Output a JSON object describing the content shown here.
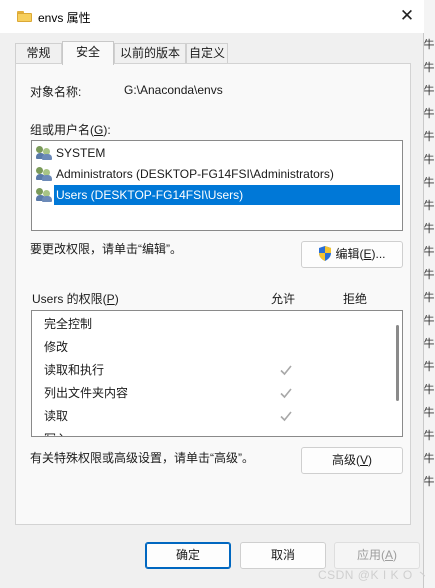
{
  "window": {
    "title": "envs 属性",
    "close_glyph": "✕"
  },
  "tabs": [
    {
      "label": "常规",
      "active": false
    },
    {
      "label": "安全",
      "active": true
    },
    {
      "label": "以前的版本",
      "active": false
    },
    {
      "label": "自定义",
      "active": false
    }
  ],
  "security": {
    "object_name_label": "对象名称:",
    "object_name_value": "G:\\Anaconda\\envs",
    "group_label_pre": "组或用户名(",
    "group_label_key": "G",
    "group_label_post": "):",
    "users": [
      {
        "name": "SYSTEM",
        "selected": false
      },
      {
        "name": "Administrators (DESKTOP-FG14FSI\\Administrators)",
        "selected": false
      },
      {
        "name": "Users (DESKTOP-FG14FSI\\Users)",
        "selected": true
      }
    ],
    "edit_hint": "要更改权限，请单击“编辑”。",
    "edit_button_pre": "编辑(",
    "edit_button_key": "E",
    "edit_button_post": ")...",
    "permissions_label_pre": "Users 的权限(",
    "permissions_label_key": "P",
    "permissions_label_post": ")",
    "allow_header": "允许",
    "deny_header": "拒绝",
    "permissions": [
      {
        "name": "完全控制",
        "allow": false,
        "deny": false
      },
      {
        "name": "修改",
        "allow": false,
        "deny": false
      },
      {
        "name": "读取和执行",
        "allow": true,
        "deny": false
      },
      {
        "name": "列出文件夹内容",
        "allow": true,
        "deny": false
      },
      {
        "name": "读取",
        "allow": true,
        "deny": false
      },
      {
        "name": "写入",
        "allow": false,
        "deny": false
      }
    ],
    "advanced_hint": "有关特殊权限或高级设置，请单击“高级”。",
    "advanced_button_pre": "高级(",
    "advanced_button_key": "V",
    "advanced_button_post": ")"
  },
  "footer": {
    "ok_label": "确定",
    "cancel_label": "取消",
    "apply_label_pre": "应用(",
    "apply_label_key": "A",
    "apply_label_post": ")"
  },
  "background_chars": [
    "牛",
    "牛",
    "牛",
    "牛",
    "牛",
    "牛",
    "牛",
    "牛",
    "牛",
    "牛",
    "牛",
    "牛",
    "牛",
    "牛",
    "牛",
    "牛",
    "牛",
    "牛",
    "牛",
    "牛"
  ],
  "watermark": "CSDN @K I K O 丶"
}
